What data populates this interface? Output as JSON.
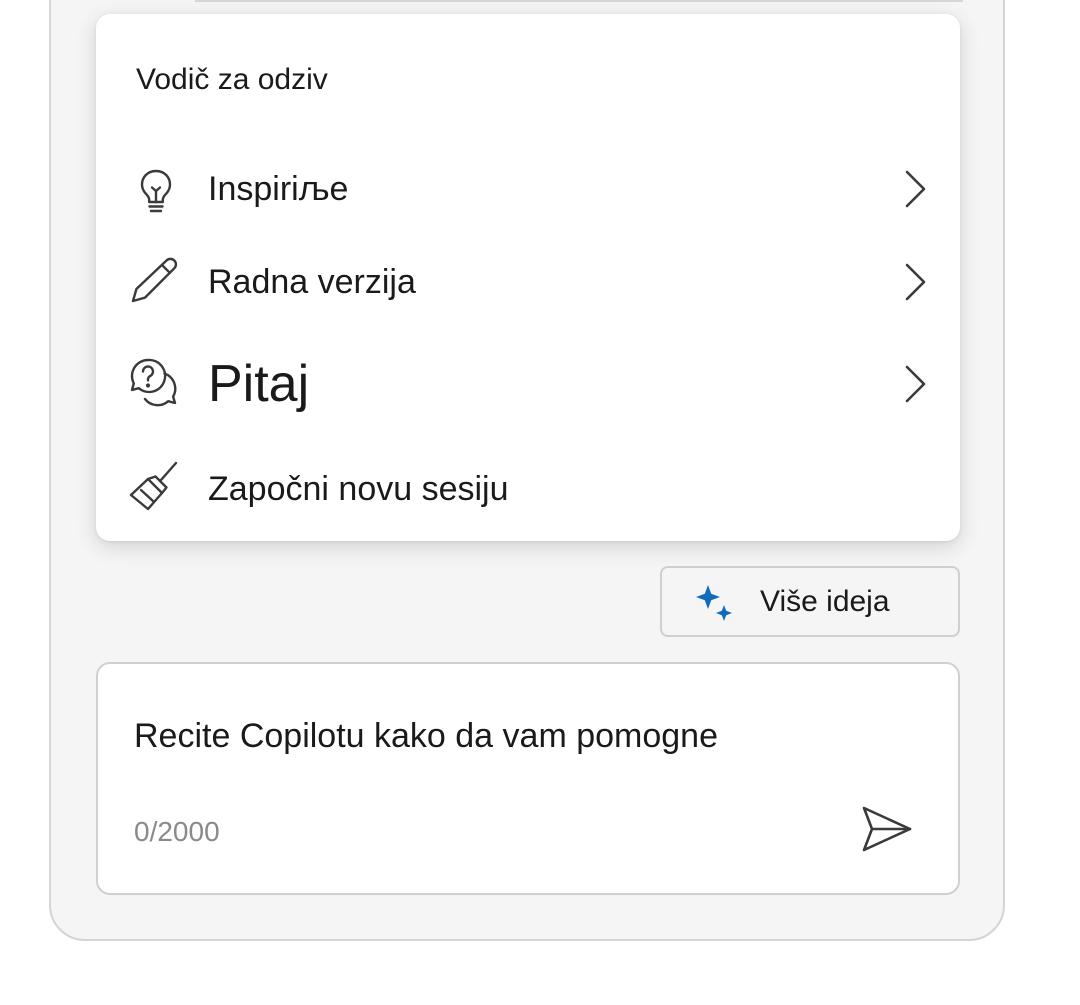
{
  "response_guide": {
    "header": "Vodič za odziv",
    "items": [
      {
        "label": "Inspiriљe",
        "icon": "lightbulb-icon",
        "has_submenu": true
      },
      {
        "label": "Radna verzija",
        "icon": "pencil-icon",
        "has_submenu": true
      },
      {
        "label": "Pitaj",
        "icon": "chat-question-icon",
        "has_submenu": true
      },
      {
        "label": "Započni novu sesiju",
        "icon": "broom-icon",
        "has_submenu": false
      }
    ]
  },
  "more_ideas": {
    "label": "Više ideja",
    "icon": "sparkle-icon",
    "icon_color": "#0f6cbd"
  },
  "composer": {
    "placeholder": "Recite Copilotu kako da vam pomogne",
    "counter": "0/2000",
    "send_icon": "send-icon"
  }
}
